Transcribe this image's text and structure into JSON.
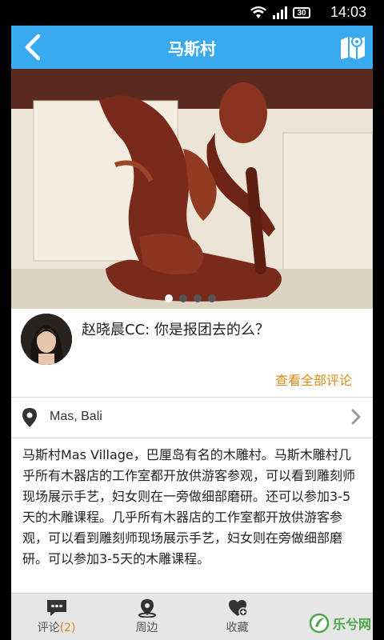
{
  "status": {
    "time": "14:03",
    "battery": "30"
  },
  "header": {
    "title": "马斯村"
  },
  "hero": {
    "slides": 4,
    "active_index": 0
  },
  "comment": {
    "text": "赵晓晨CC: 你是报团去的么？",
    "view_all": "查看全部评论"
  },
  "location": {
    "address": "Mas, Bali"
  },
  "description": "马斯村Mas Village，巴厘岛有名的木雕村。马斯木雕村几乎所有木器店的工作室都开放供游客参观，可以看到雕刻师现场展示手艺，妇女则在一旁做细部磨研。还可以参加3-5天的木雕课程。几乎所有木器店的工作室都开放供游客参观，可以看到雕刻师现场展示手艺，妇女则在旁做细部磨研。可以参加3-5天的木雕课程。",
  "tabs": {
    "comments": {
      "label": "评论",
      "count": "(2)"
    },
    "nearby": {
      "label": "周边"
    },
    "favorite": {
      "label": "收藏"
    }
  },
  "watermark": {
    "text": "乐兮网"
  },
  "colors": {
    "accent": "#3aaaf0",
    "highlight": "#d98a1a",
    "wood": "#7a2a1a"
  }
}
